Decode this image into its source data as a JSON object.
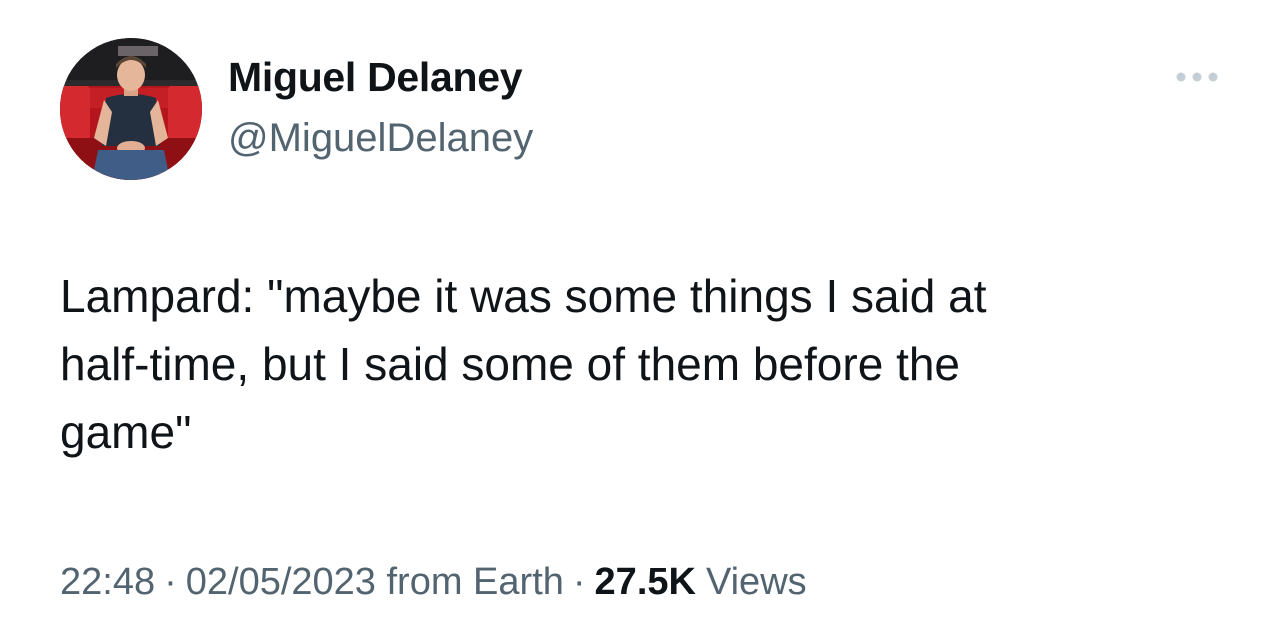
{
  "author": {
    "name": "Miguel Delaney",
    "handle": "@MiguelDelaney"
  },
  "more_menu": {
    "icon": "more-dots-icon"
  },
  "tweet": {
    "text": "Lampard: \"maybe it was some things I said at\nhalf-time, but I said some of them before the\ngame\""
  },
  "meta": {
    "time": "22:48",
    "separator": "·",
    "date": "02/05/2023",
    "source": "from Earth",
    "views_count": "27.5K",
    "views_label": "Views"
  },
  "colors": {
    "text_primary": "#0f1419",
    "text_secondary": "#536471",
    "more_dots": "#c4cdd4",
    "background": "#ffffff"
  }
}
